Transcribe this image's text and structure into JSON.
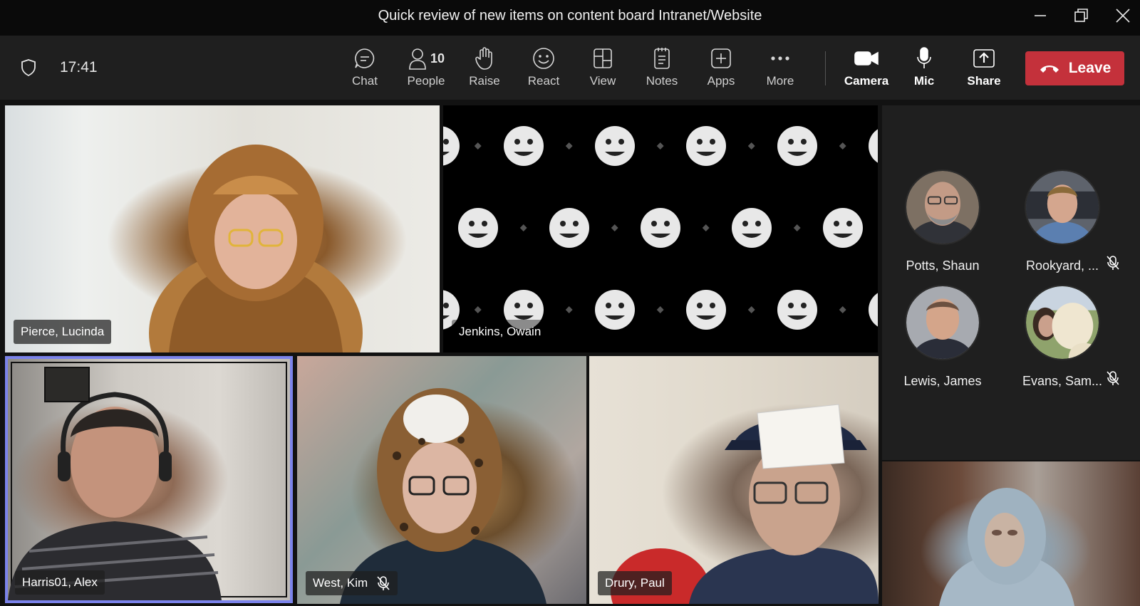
{
  "window": {
    "title": "Quick review of new items on content board Intranet/Website",
    "controls": [
      "minimize-icon",
      "restore-icon",
      "close-icon"
    ]
  },
  "toolbar": {
    "time": "17:41",
    "chat_label": "Chat",
    "people_label": "People",
    "people_count": "10",
    "raise_label": "Raise",
    "react_label": "React",
    "view_label": "View",
    "notes_label": "Notes",
    "apps_label": "Apps",
    "more_label": "More",
    "camera_label": "Camera",
    "mic_label": "Mic",
    "share_label": "Share",
    "leave_label": "Leave"
  },
  "tiles": [
    {
      "name": "Pierce, Lucinda",
      "muted": false
    },
    {
      "name": "Jenkins, Owain",
      "muted": false
    },
    {
      "name": "Harris01, Alex",
      "muted": false,
      "speaking": true
    },
    {
      "name": "West, Kim",
      "muted": true
    },
    {
      "name": "Drury, Paul",
      "muted": false
    }
  ],
  "roster": [
    {
      "name": "Potts, Shaun",
      "muted": false
    },
    {
      "name": "Rookyard, ...",
      "muted": true
    },
    {
      "name": "Lewis, James",
      "muted": false
    },
    {
      "name": "Evans, Sam...",
      "muted": true
    }
  ],
  "colors": {
    "leave": "#c4313b",
    "speaker_highlight": "#7b83eb",
    "toolbar": "#1f1f1f"
  }
}
